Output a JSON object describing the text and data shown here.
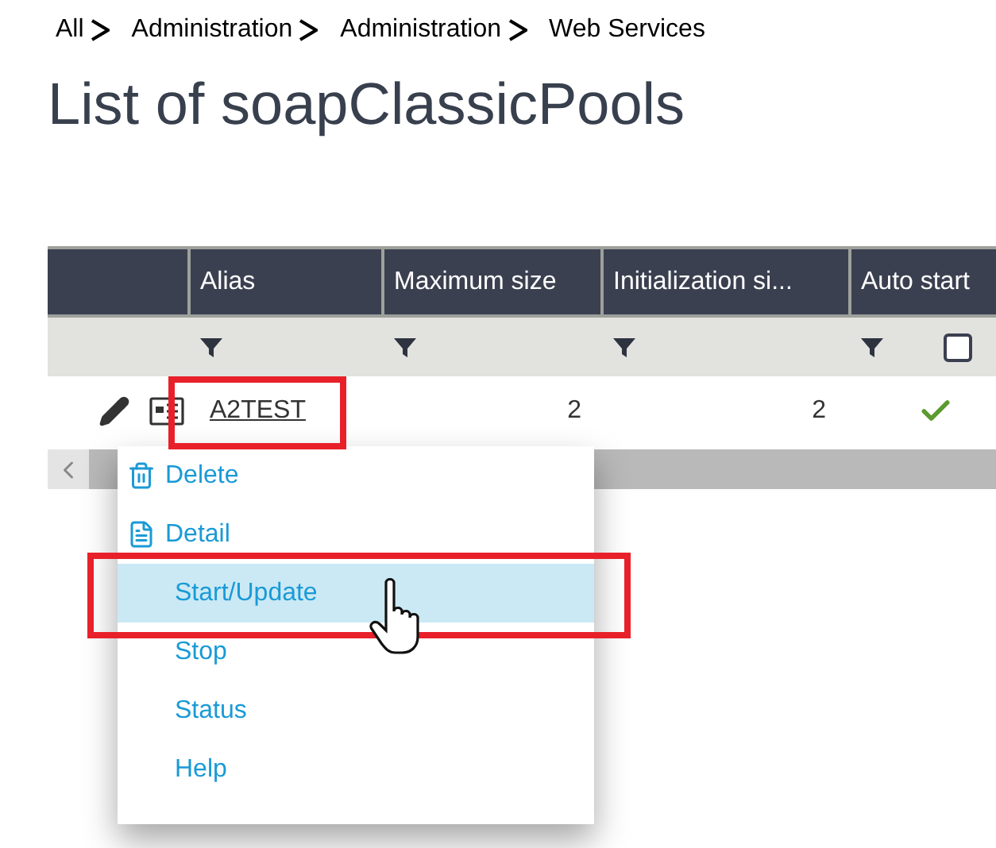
{
  "breadcrumb": [
    "All",
    "Administration",
    "Administration",
    "Web Services"
  ],
  "title": "List of soapClassicPools",
  "table": {
    "columns": [
      "Alias",
      "Maximum size",
      "Initialization si...",
      "Auto start"
    ],
    "filter_select_all": {
      "checked": false
    },
    "rows": [
      {
        "alias": "A2TEST",
        "maximum_size": "2",
        "initialization_size": "2",
        "auto_start": true
      }
    ]
  },
  "context_menu": [
    {
      "label": "Delete",
      "kind": "trash",
      "selected": false
    },
    {
      "label": "Detail",
      "kind": "document",
      "selected": false
    },
    {
      "label": "Start/Update",
      "kind": "plain",
      "selected": true
    },
    {
      "label": "Stop",
      "kind": "plain",
      "selected": false
    },
    {
      "label": "Status",
      "kind": "plain",
      "selected": false
    },
    {
      "label": "Help",
      "kind": "plain",
      "selected": false
    }
  ]
}
